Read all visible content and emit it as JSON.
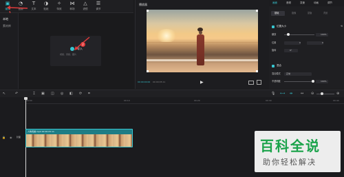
{
  "toolbar": {
    "items": [
      {
        "label": "媒体",
        "glyph": "▣"
      },
      {
        "label": "音频",
        "glyph": "◔"
      },
      {
        "label": "文本",
        "glyph": "T"
      },
      {
        "label": "贴纸",
        "glyph": "◑"
      },
      {
        "label": "特效",
        "glyph": "✧"
      },
      {
        "label": "转场",
        "glyph": "⋈"
      },
      {
        "label": "滤镜",
        "glyph": "△"
      },
      {
        "label": "调节",
        "glyph": "☰"
      }
    ]
  },
  "media": {
    "sidebar": [
      "本地",
      "素材库"
    ],
    "import_label": "导入",
    "import_sub": "视频、音频、图片",
    "annotation_1": "1",
    "annotation_2": "2"
  },
  "player": {
    "title": "播放器",
    "timecode": "00:00:00:00",
    "duration": "00:00:05:11"
  },
  "props": {
    "tabs": [
      "画面",
      "音频",
      "变速",
      "动画",
      "调节"
    ],
    "subtabs": [
      "基础",
      "抠像",
      "蒙版",
      "背景"
    ],
    "section1": "位置大小",
    "scale_label": "缩放",
    "scale_value": "100%",
    "pos_label": "位置",
    "pos_x": "0",
    "pos_y": "0",
    "rotate_label": "旋转",
    "rotate_value": "0°",
    "section2": "混合",
    "blend_label": "混合模式",
    "blend_value": "正常",
    "opacity_label": "不透明度",
    "opacity_value": "100%"
  },
  "timeline": {
    "ticks": [
      "00:00",
      "00:10",
      "00:20",
      "00:30",
      "00:40"
    ],
    "clip_label": "人物海滩.mp4 00:00:05:11",
    "track_label": "封面"
  },
  "watermark": {
    "title": "百科全说",
    "subtitle": "助你轻松解决"
  },
  "colors": {
    "accent": "#37c6d0",
    "annotation": "#e23b3b",
    "clip": "#1e7d85"
  }
}
